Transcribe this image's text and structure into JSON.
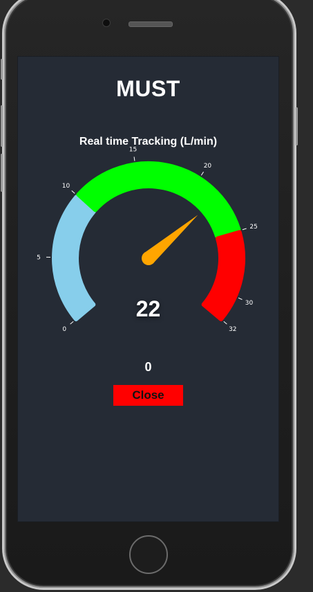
{
  "app": {
    "title": "MUST",
    "subtitle": "Real time Tracking (L/min)"
  },
  "gauge": {
    "min": 0,
    "max": 32,
    "value": 22,
    "value_label": "22",
    "ticks": [
      {
        "value": 0,
        "label": "0"
      },
      {
        "value": 5,
        "label": "5"
      },
      {
        "value": 10,
        "label": "10"
      },
      {
        "value": 15,
        "label": "15"
      },
      {
        "value": 20,
        "label": "20"
      },
      {
        "value": 25,
        "label": "25"
      },
      {
        "value": 30,
        "label": "30"
      },
      {
        "value": 32,
        "label": "32"
      }
    ],
    "bands": [
      {
        "from": 0,
        "to": 10,
        "color": "#87ceeb"
      },
      {
        "from": 10,
        "to": 25,
        "color": "#00ff00"
      },
      {
        "from": 25,
        "to": 32,
        "color": "#ff0000"
      }
    ],
    "needle_color": "#ffa500"
  },
  "reading": {
    "value": "0"
  },
  "actions": {
    "close_label": "Close",
    "close_color": "#ff0000"
  }
}
